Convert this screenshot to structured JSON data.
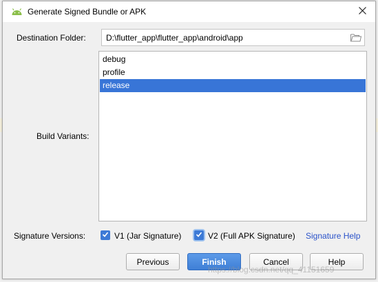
{
  "window": {
    "title": "Generate Signed Bundle or APK",
    "app_icon": "android-icon",
    "close_icon": "close-icon"
  },
  "destination": {
    "label": "Destination Folder:",
    "value": "D:\\flutter_app\\flutter_app\\android\\app",
    "browse_icon": "folder-icon"
  },
  "build_variants": {
    "label": "Build Variants:",
    "items": [
      {
        "label": "debug",
        "selected": false
      },
      {
        "label": "profile",
        "selected": false
      },
      {
        "label": "release",
        "selected": true
      }
    ]
  },
  "signature": {
    "label": "Signature Versions:",
    "v1": {
      "label": "V1 (Jar Signature)",
      "checked": true
    },
    "v2": {
      "label": "V2 (Full APK Signature)",
      "checked": true
    },
    "help_link": "Signature Help"
  },
  "buttons": {
    "previous": "Previous",
    "finish": "Finish",
    "cancel": "Cancel",
    "help": "Help"
  },
  "watermark": "https://blog.csdn.net/qq_41151659",
  "colors": {
    "selection": "#3875d7",
    "primary_button": "#4a8ae0",
    "link": "#2a52c9",
    "checkbox": "#3d7ad6"
  }
}
